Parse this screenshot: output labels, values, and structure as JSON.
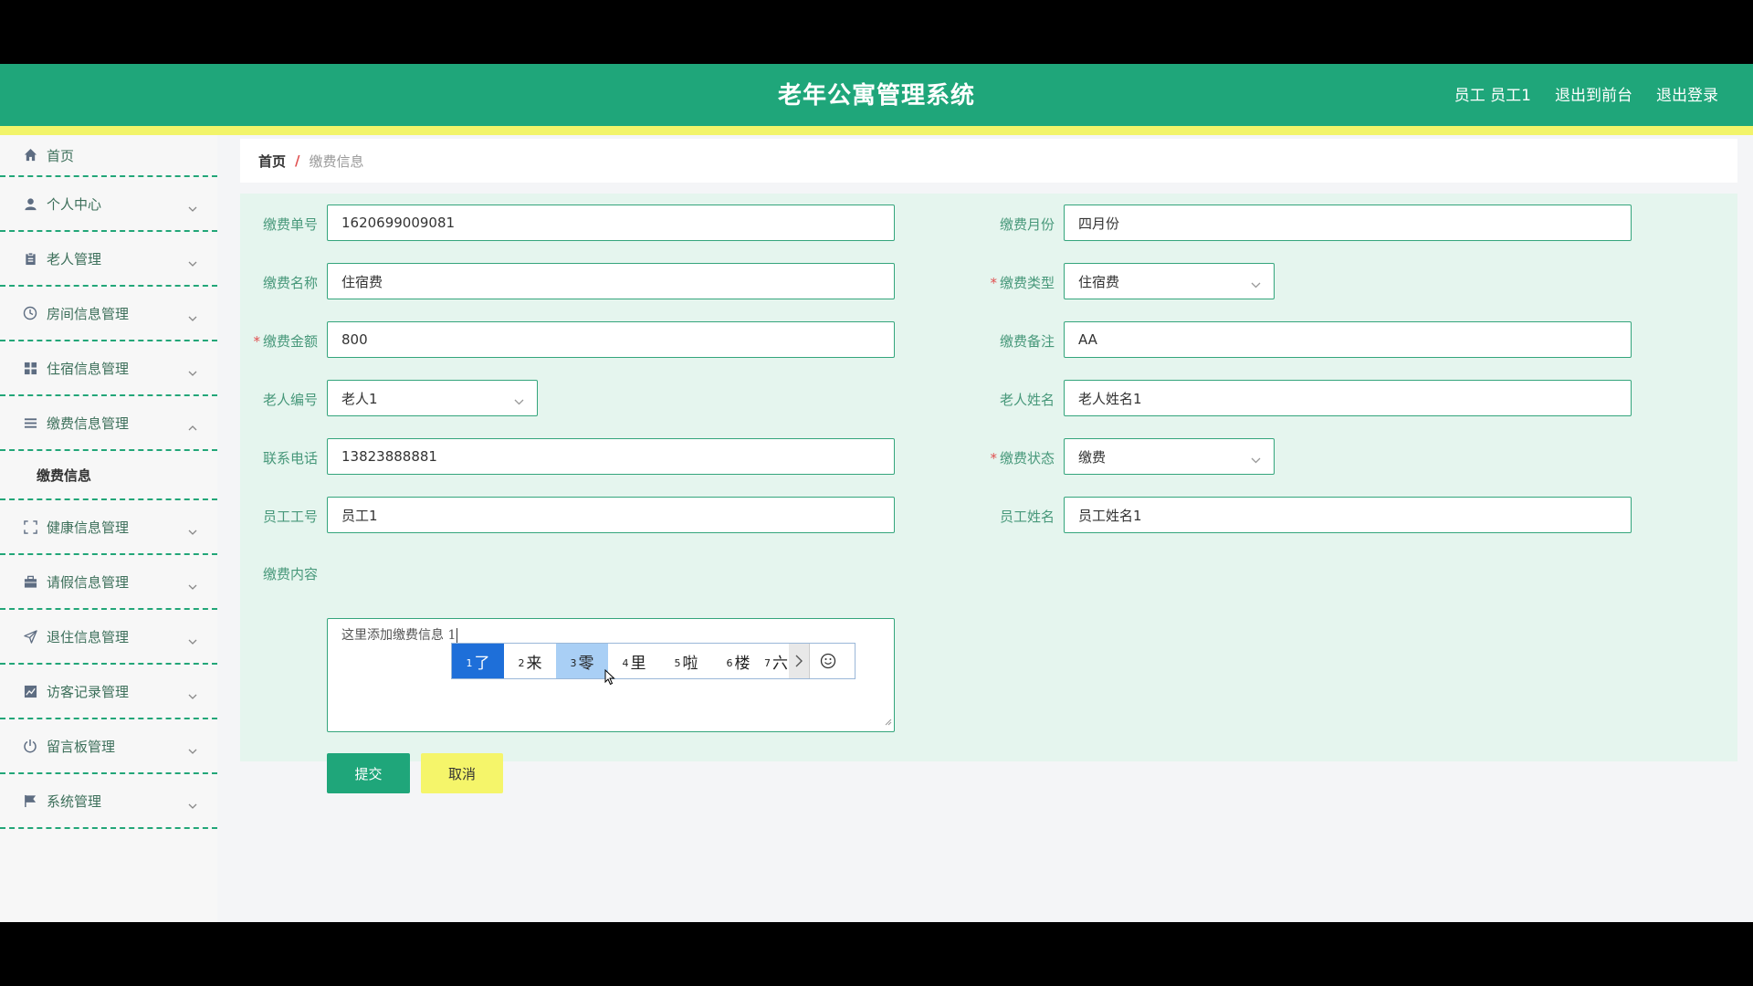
{
  "header": {
    "title": "老年公寓管理系统",
    "user": "员工 员工1",
    "to_front": "退出到前台",
    "logout": "退出登录"
  },
  "sidebar": {
    "items": [
      {
        "label": "首页",
        "icon": "home-icon"
      },
      {
        "label": "个人中心",
        "icon": "user-icon"
      },
      {
        "label": "老人管理",
        "icon": "clipboard-icon"
      },
      {
        "label": "房间信息管理",
        "icon": "clock-icon"
      },
      {
        "label": "住宿信息管理",
        "icon": "grid-icon"
      },
      {
        "label": "缴费信息管理",
        "icon": "list-icon",
        "expanded": true
      },
      {
        "label": "健康信息管理",
        "icon": "scan-icon"
      },
      {
        "label": "请假信息管理",
        "icon": "briefcase-icon"
      },
      {
        "label": "退住信息管理",
        "icon": "send-icon"
      },
      {
        "label": "访客记录管理",
        "icon": "chart-icon"
      },
      {
        "label": "留言板管理",
        "icon": "power-icon"
      },
      {
        "label": "系统管理",
        "icon": "flag-icon"
      }
    ],
    "submenu": "缴费信息"
  },
  "breadcrumb": {
    "home": "首页",
    "sep": "/",
    "current": "缴费信息"
  },
  "form": {
    "fee_no": {
      "label": "缴费单号",
      "value": "1620699009081"
    },
    "fee_month": {
      "label": "缴费月份",
      "value": "四月份"
    },
    "fee_name": {
      "label": "缴费名称",
      "value": "住宿费"
    },
    "fee_type": {
      "label": "缴费类型",
      "value": "住宿费",
      "required": true
    },
    "fee_amount": {
      "label": "缴费金额",
      "value": "800",
      "required": true
    },
    "fee_remark": {
      "label": "缴费备注",
      "value": "AA"
    },
    "elder_no": {
      "label": "老人编号",
      "value": "老人1"
    },
    "elder_name": {
      "label": "老人姓名",
      "value": "老人姓名1"
    },
    "phone": {
      "label": "联系电话",
      "value": "13823888881"
    },
    "fee_status": {
      "label": "缴费状态",
      "value": "缴费",
      "required": true
    },
    "staff_no": {
      "label": "员工工号",
      "value": "员工1"
    },
    "staff_name": {
      "label": "员工姓名",
      "value": "员工姓名1"
    },
    "content": {
      "label": "缴费内容",
      "value": "这里添加缴费信息 1"
    }
  },
  "ime": {
    "candidates": [
      {
        "num": "1",
        "text": "了"
      },
      {
        "num": "2",
        "text": "来"
      },
      {
        "num": "3",
        "text": "零"
      },
      {
        "num": "4",
        "text": "里"
      },
      {
        "num": "5",
        "text": "啦"
      },
      {
        "num": "6",
        "text": "楼"
      },
      {
        "num": "7",
        "text": "六"
      }
    ]
  },
  "buttons": {
    "submit": "提交",
    "cancel": "取消"
  },
  "colors": {
    "primary": "#1fa67a",
    "accent_yellow": "#f2f46a",
    "panel": "#e5f5ee",
    "required": "#e05050"
  }
}
